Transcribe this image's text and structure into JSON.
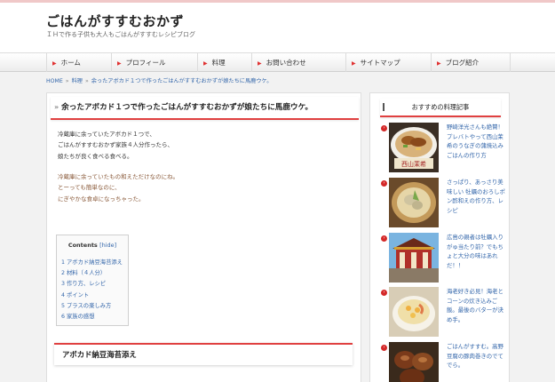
{
  "site": {
    "title": "ごはんがすすむおかず",
    "description": "ＩＨで作る子供も大人もごはんがすすむレシピブログ"
  },
  "nav": [
    {
      "label": "ホーム"
    },
    {
      "label": "プロフィール"
    },
    {
      "label": "料理"
    },
    {
      "label": "お問い合わせ"
    },
    {
      "label": "サイトマップ"
    },
    {
      "label": "ブログ紹介"
    }
  ],
  "breadcrumb": [
    "HOME",
    "料理",
    "余ったアボカド１つで作ったごはんがすすむおかずが娘たちに馬鹿ウケ。"
  ],
  "post": {
    "title": "余ったアボカド１つで作ったごはんがすすむおかずが娘たちに馬鹿ウケ。",
    "p1": [
      "冷蔵庫に余っていたアボカド１つで、",
      "ごはんがすすむおかず家族４人分作ったら、",
      "娘たちが良く食べる食べる。"
    ],
    "p2": [
      "冷蔵庫に余っていたもの和えただけなのにね。",
      "とーっても簡単なのに、",
      "にぎやかな食卓になっちゃった。"
    ],
    "toc": {
      "title": "Contents",
      "hide": "[hide]",
      "items": [
        "1 アボカド納豆海苔添え",
        "2 材料（４人分）",
        "3 作り方、レシピ",
        "4 ポイント",
        "5 プラスの楽しみ方",
        "6 家族の感想"
      ]
    },
    "section_heading": "アボカド納豆海苔添え"
  },
  "sidebar": {
    "title": "おすすめの料理記事",
    "items": [
      {
        "text": "野崎洋光さんも絶賛！プレバトやって西山茉希のうなぎの蒲焼込みごはんの作り方",
        "thumb_label": "西山茉希"
      },
      {
        "text": "さっぱり、あっさり美味しい 牡蠣のおろしポン酢和えの作り方、レシピ"
      },
      {
        "text": "広島の親者は牡蠣入り がゅ当たり前？でもちょと大分の味はあれだ！！"
      },
      {
        "text": "海老好き必見！海老とコーンの炊き込みご飯。最後のバターが決め手。"
      },
      {
        "text": "ごはんがすすむ。高野豆腐の豚肉巻きのでてでら。"
      }
    ]
  },
  "colors": {
    "accent": "#e04040",
    "link": "#3366aa",
    "background": "#f2f2f2"
  }
}
